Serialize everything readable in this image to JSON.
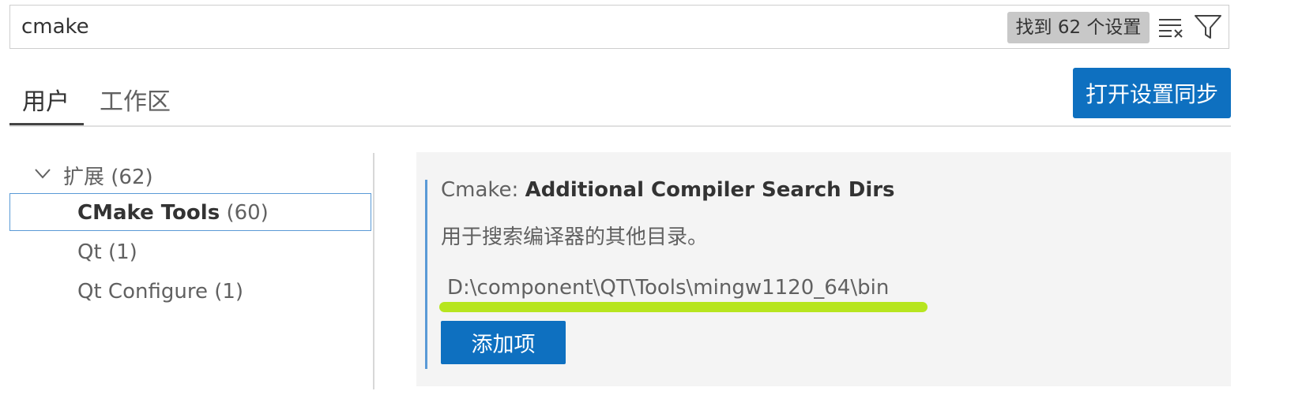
{
  "search": {
    "value": "cmake",
    "results_badge": "找到 62 个设置",
    "clear_icon": "clear-filter-icon",
    "filter_icon": "filter-icon"
  },
  "tabs": [
    {
      "label": "用户",
      "active": true
    },
    {
      "label": "工作区",
      "active": false
    }
  ],
  "sync_button": "打开设置同步",
  "tree": {
    "extensions": {
      "label": "扩展",
      "count": "(62)",
      "expanded": true
    },
    "children": [
      {
        "label": "CMake Tools",
        "count": "(60)",
        "selected": true
      },
      {
        "label": "Qt",
        "count": "(1)"
      },
      {
        "label": "Qt Configure",
        "count": "(1)"
      }
    ]
  },
  "setting": {
    "category": "Cmake: ",
    "name": "Additional Compiler Search Dirs",
    "description": "用于搜索编译器的其他目录。",
    "items": [
      "D:\\component\\QT\\Tools\\mingw1120_64\\bin"
    ],
    "add_button": "添加项"
  },
  "colors": {
    "accent": "#0e70c0",
    "highlight": "#b7e51f",
    "selection_border": "#5a9ad6"
  }
}
